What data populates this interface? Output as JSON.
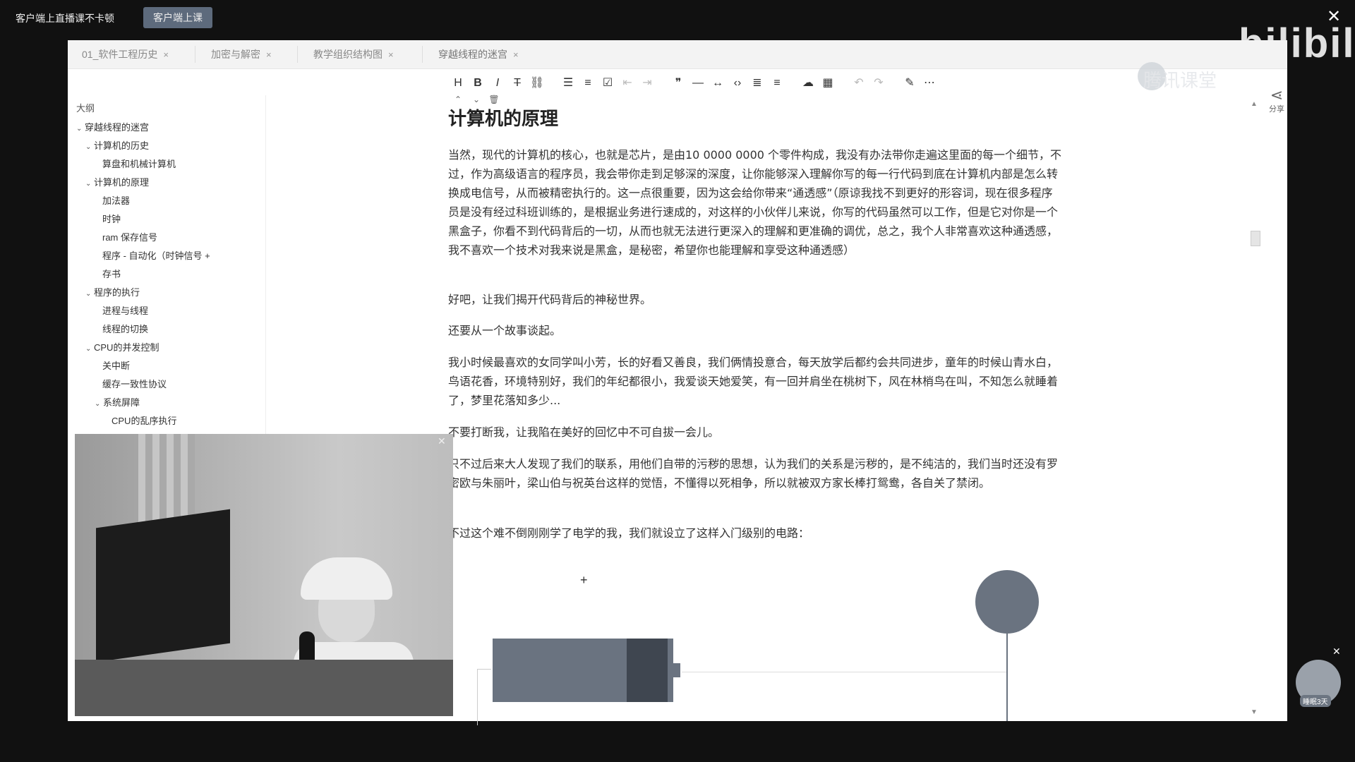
{
  "live_bar": {
    "label": "客户端上直播课不卡顿",
    "button": "客户端上课",
    "close": "✕",
    "brand": "bilibili",
    "tencent": "腾讯课堂"
  },
  "tabs": [
    {
      "label": "01_软件工程历史"
    },
    {
      "label": "加密与解密"
    },
    {
      "label": "教学组织结构图"
    },
    {
      "label": "穿越线程的迷宫"
    }
  ],
  "tab_close": "×",
  "toolbar": {
    "icons": [
      "heading-icon",
      "bold-icon",
      "italic-icon",
      "strikethrough-icon",
      "link-icon",
      "bullet-list-icon",
      "ordered-list-icon",
      "task-list-icon",
      "outdent-icon",
      "indent-icon",
      "quote-icon",
      "horizontal-rule-icon",
      "code-icon",
      "inline-code-icon",
      "table-of-contents-icon",
      "align-icon",
      "cloud-upload-icon",
      "table-icon",
      "undo-icon",
      "redo-icon",
      "pen-icon",
      "more-icon"
    ]
  },
  "outline": {
    "title": "大纲",
    "items": [
      {
        "label": "穿越线程的迷宫",
        "level": 0,
        "caret": "⌄"
      },
      {
        "label": "计算机的历史",
        "level": 1,
        "caret": "⌄"
      },
      {
        "label": "算盘和机械计算机",
        "level": 2,
        "caret": ""
      },
      {
        "label": "计算机的原理",
        "level": 1,
        "caret": "⌄"
      },
      {
        "label": "加法器",
        "level": 2,
        "caret": ""
      },
      {
        "label": "时钟",
        "level": 2,
        "caret": ""
      },
      {
        "label": "ram 保存信号",
        "level": 2,
        "caret": ""
      },
      {
        "label": "程序 - 自动化（时钟信号 +",
        "level": 2,
        "caret": ""
      },
      {
        "label": "存书",
        "level": 2,
        "caret": ""
      },
      {
        "label": "程序的执行",
        "level": 1,
        "caret": "⌄"
      },
      {
        "label": "进程与线程",
        "level": 2,
        "caret": ""
      },
      {
        "label": "线程的切换",
        "level": 2,
        "caret": ""
      },
      {
        "label": "CPU的并发控制",
        "level": 1,
        "caret": "⌄"
      },
      {
        "label": "关中断",
        "level": 2,
        "caret": ""
      },
      {
        "label": "缓存一致性协议",
        "level": 2,
        "caret": ""
      },
      {
        "label": "系统屏障",
        "level": 2,
        "caret": "⌄"
      },
      {
        "label": "CPU的乱序执行",
        "level": 3,
        "caret": ""
      }
    ]
  },
  "document": {
    "heading": "计算机的原理",
    "paragraphs": [
      "当然，现代的计算机的核心，也就是芯片，是由10 0000 0000 个零件构成，我没有办法带你走遍这里面的每一个细节，不过，作为高级语言的程序员，我会带你走到足够深的深度，让你能够深入理解你写的每一行代码到底在计算机内部是怎么转换成电信号，从而被精密执行的。这一点很重要，因为这会给你带来“通透感”（原谅我找不到更好的形容词，现在很多程序员是没有经过科班训练的，是根据业务进行速成的，对这样的小伙伴儿来说，你写的代码虽然可以工作，但是它对你是一个黑盒子，你看不到代码背后的一切，从而也就无法进行更深入的理解和更准确的调优，总之，我个人非常喜欢这种通透感，我不喜欢一个技术对我来说是黑盒，是秘密，希望你也能理解和享受这种通透感）",
      "好吧，让我们揭开代码背后的神秘世界。",
      "还要从一个故事谈起。",
      "我小时候最喜欢的女同学叫小芳，长的好看又善良，我们俩情投意合，每天放学后都约会共同进步，童年的时候山青水白，鸟语花香，环境特别好，我们的年纪都很小，我爱谈天她爱笑，有一回并肩坐在桃树下，风在林梢鸟在叫，不知怎么就睡着了，梦里花落知多少...",
      "不要打断我，让我陷在美好的回忆中不可自拔一会儿。",
      "只不过后来大人发现了我们的联系，用他们自带的污秽的思想，认为我们的关系是污秽的，是不纯洁的，我们当时还没有罗密欧与朱丽叶，梁山伯与祝英台这样的觉悟，不懂得以死相争，所以就被双方家长棒打鸳鸯，各自关了禁闭。",
      "不过这个难不倒刚刚学了电学的我，我们就设立了这样入门级别的电路："
    ]
  },
  "circuit": {
    "minus": "-",
    "plus": "+"
  },
  "share_label": "分享",
  "mascot_label": "睡眠3天",
  "colors": {
    "accent": "#5d6a7c",
    "battery": "#6a7380"
  }
}
